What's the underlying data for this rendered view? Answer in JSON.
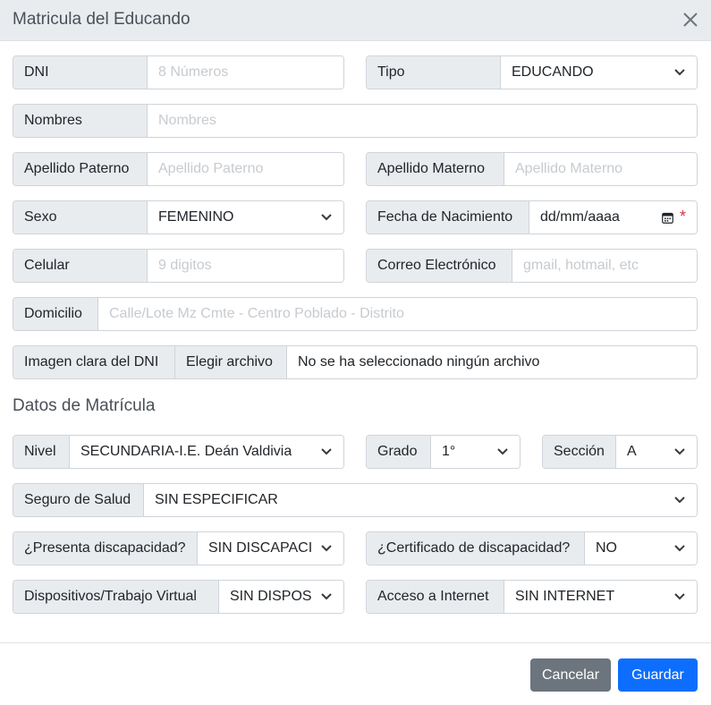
{
  "modal": {
    "title": "Matricula del Educando"
  },
  "fields": {
    "dni": {
      "label": "DNI",
      "placeholder": "8 Números"
    },
    "tipo": {
      "label": "Tipo",
      "value": "EDUCANDO"
    },
    "nombres": {
      "label": "Nombres",
      "placeholder": "Nombres"
    },
    "apellido_paterno": {
      "label": "Apellido Paterno",
      "placeholder": "Apellido Paterno"
    },
    "apellido_materno": {
      "label": "Apellido Materno",
      "placeholder": "Apellido Materno"
    },
    "sexo": {
      "label": "Sexo",
      "value": "FEMENINO"
    },
    "fecha_nacimiento": {
      "label": "Fecha de Nacimiento",
      "value": "dd/mm/aaaa",
      "required_mark": "*"
    },
    "celular": {
      "label": "Celular",
      "placeholder": "9 digitos"
    },
    "correo": {
      "label": "Correo Electrónico",
      "placeholder": "gmail, hotmail, etc"
    },
    "domicilio": {
      "label": "Domicilio",
      "placeholder": "Calle/Lote Mz Cmte - Centro Poblado - Distrito"
    },
    "imagen_dni": {
      "label": "Imagen clara del DNI",
      "button": "Elegir archivo",
      "status": "No se ha seleccionado ningún archivo"
    }
  },
  "matricula": {
    "section_title": "Datos de Matrícula",
    "nivel": {
      "label": "Nivel",
      "value": "SECUNDARIA-I.E. Deán Valdivia"
    },
    "grado": {
      "label": "Grado",
      "value": "1°"
    },
    "seccion": {
      "label": "Sección",
      "value": "A"
    },
    "seguro": {
      "label": "Seguro de Salud",
      "value": "SIN ESPECIFICAR"
    },
    "discapacidad": {
      "label": "¿Presenta discapacidad?",
      "value": "SIN DISCAPACIDAD"
    },
    "certificado": {
      "label": "¿Certificado de discapacidad?",
      "value": "NO"
    },
    "dispositivos": {
      "label": "Dispositivos/Trabajo Virtual",
      "value": "SIN DISPOSITIVOS"
    },
    "internet": {
      "label": "Acceso a Internet",
      "value": "SIN INTERNET"
    }
  },
  "footer": {
    "cancel_label": "Cancelar",
    "save_label": "Guardar"
  },
  "colors": {
    "header_bg": "#e9ecef",
    "cancel": "#6c757d",
    "save": "#0d6efd",
    "required": "#dc3545"
  },
  "icons": {
    "close": "close-icon",
    "select": "chevron-down-icon",
    "calendar": "calendar-icon"
  }
}
